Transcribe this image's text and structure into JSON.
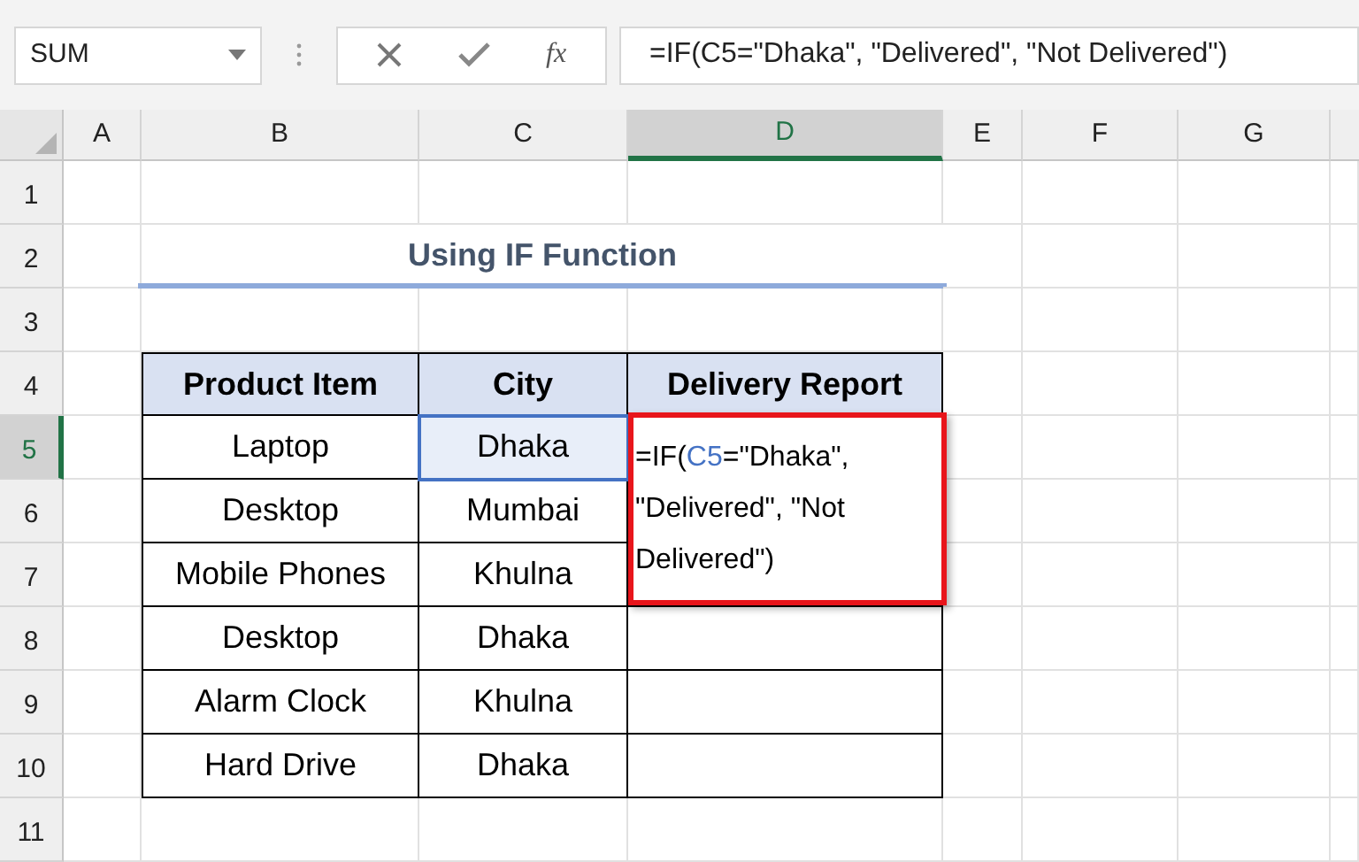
{
  "name_box": {
    "value": "SUM"
  },
  "formula_buttons": {
    "function": "fx"
  },
  "formula_bar": {
    "value": "=IF(C5=\"Dhaka\", \"Delivered\", \"Not Delivered\")"
  },
  "columns": [
    {
      "label": "A",
      "selected": false
    },
    {
      "label": "B",
      "selected": false
    },
    {
      "label": "C",
      "selected": false
    },
    {
      "label": "D",
      "selected": true
    },
    {
      "label": "E",
      "selected": false
    },
    {
      "label": "F",
      "selected": false
    },
    {
      "label": "G",
      "selected": false
    }
  ],
  "rows": [
    {
      "label": "1",
      "selected": false
    },
    {
      "label": "2",
      "selected": false
    },
    {
      "label": "3",
      "selected": false
    },
    {
      "label": "4",
      "selected": false
    },
    {
      "label": "5",
      "selected": true
    },
    {
      "label": "6",
      "selected": false
    },
    {
      "label": "7",
      "selected": false
    },
    {
      "label": "8",
      "selected": false
    },
    {
      "label": "9",
      "selected": false
    },
    {
      "label": "10",
      "selected": false
    },
    {
      "label": "11",
      "selected": false
    }
  ],
  "title": "Using IF Function",
  "table": {
    "columns": [
      "Product Item",
      "City",
      "Delivery Report"
    ],
    "rows": [
      {
        "product": "Laptop",
        "city": "Dhaka",
        "referenced": true
      },
      {
        "product": "Desktop",
        "city": "Mumbai",
        "referenced": false
      },
      {
        "product": "Mobile Phones",
        "city": "Khulna",
        "referenced": false
      },
      {
        "product": "Desktop",
        "city": "Dhaka",
        "referenced": false
      },
      {
        "product": "Alarm Clock",
        "city": "Khulna",
        "referenced": false
      },
      {
        "product": "Hard Drive",
        "city": "Dhaka",
        "referenced": false
      }
    ]
  },
  "cell_editor": {
    "parts": [
      {
        "kind": "plain",
        "text": "=IF("
      },
      {
        "kind": "reference",
        "text": "C5"
      },
      {
        "kind": "plain",
        "text": "=\"Dhaka\", \"Delivered\", \"Not Delivered\")"
      }
    ]
  }
}
